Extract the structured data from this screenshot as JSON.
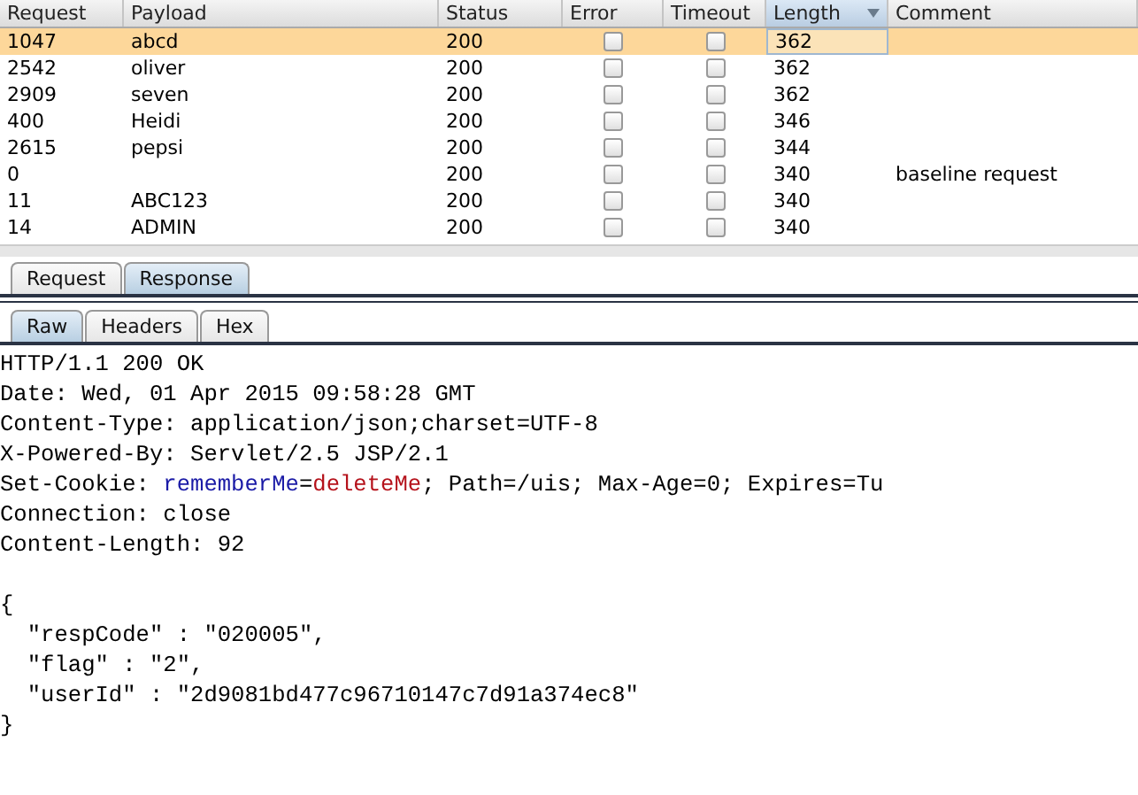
{
  "table": {
    "columns": [
      {
        "label": "Request",
        "sorted": false
      },
      {
        "label": "Payload",
        "sorted": false
      },
      {
        "label": "Status",
        "sorted": false
      },
      {
        "label": "Error",
        "sorted": false
      },
      {
        "label": "Timeout",
        "sorted": false
      },
      {
        "label": "Length",
        "sorted": true
      },
      {
        "label": "Comment",
        "sorted": false
      }
    ],
    "rows": [
      {
        "request": "1047",
        "payload": "abcd",
        "status": "200",
        "error": false,
        "timeout": false,
        "length": "362",
        "selected": true
      },
      {
        "request": "2542",
        "payload": "oliver",
        "status": "200",
        "error": false,
        "timeout": false,
        "length": "362",
        "selected": false
      },
      {
        "request": "2909",
        "payload": "seven",
        "status": "200",
        "error": false,
        "timeout": false,
        "length": "362",
        "selected": false
      },
      {
        "request": "400",
        "payload": "Heidi",
        "status": "200",
        "error": false,
        "timeout": false,
        "length": "346",
        "selected": false
      },
      {
        "request": "2615",
        "payload": "pepsi",
        "status": "200",
        "error": false,
        "timeout": false,
        "length": "344",
        "selected": false
      },
      {
        "request": "0",
        "status": "200",
        "error": false,
        "timeout": false,
        "length": "340",
        "comment": "baseline request",
        "selected": false
      },
      {
        "request": "11",
        "payload": "ABC123",
        "status": "200",
        "error": false,
        "timeout": false,
        "length": "340",
        "selected": false
      },
      {
        "request": "14",
        "payload": "ADMIN",
        "status": "200",
        "error": false,
        "timeout": false,
        "length": "340",
        "selected": false
      }
    ]
  },
  "tabs": [
    {
      "label": "Request",
      "selected": false
    },
    {
      "label": "Response",
      "selected": true
    }
  ],
  "view_tabs": [
    {
      "label": "Raw",
      "selected": true
    },
    {
      "label": "Headers",
      "selected": false
    },
    {
      "label": "Hex",
      "selected": false
    }
  ],
  "response": {
    "header_lines": [
      {
        "segments": [
          {
            "text": "HTTP/1.1 200 OK",
            "kind": "plain"
          }
        ]
      },
      {
        "segments": [
          {
            "text": "Date: Wed, 01 Apr 2015 09:58:28 GMT",
            "kind": "plain"
          }
        ]
      },
      {
        "segments": [
          {
            "text": "Content-Type: application/json;charset=UTF-8",
            "kind": "plain"
          }
        ]
      },
      {
        "segments": [
          {
            "text": "X-Powered-By: Servlet/2.5 JSP/2.1",
            "kind": "plain"
          }
        ]
      },
      {
        "segments": [
          {
            "text": "Set-Cookie: ",
            "kind": "plain"
          },
          {
            "text": "rememberMe",
            "kind": "name"
          },
          {
            "text": "=",
            "kind": "plain"
          },
          {
            "text": "deleteMe",
            "kind": "value"
          },
          {
            "text": "; Path=/uis; Max-Age=0; Expires=Tu",
            "kind": "plain"
          }
        ]
      },
      {
        "segments": [
          {
            "text": "Connection: close",
            "kind": "plain"
          }
        ]
      },
      {
        "segments": [
          {
            "text": "Content-Length: 92",
            "kind": "plain"
          }
        ]
      }
    ],
    "body_lines": [
      {
        "segments": [
          {
            "text": "{",
            "kind": "plain"
          }
        ]
      },
      {
        "segments": [
          {
            "text": "  \"respCode\" : \"020005\",",
            "kind": "plain"
          }
        ]
      },
      {
        "segments": [
          {
            "text": "  \"flag\" : \"2\",",
            "kind": "plain"
          }
        ]
      },
      {
        "segments": [
          {
            "text": "  \"userId\" : \"2d9081bd477c96710147c7d91a374ec8\"",
            "kind": "plain"
          }
        ]
      },
      {
        "segments": [
          {
            "text": "}",
            "kind": "plain"
          }
        ]
      }
    ]
  }
}
